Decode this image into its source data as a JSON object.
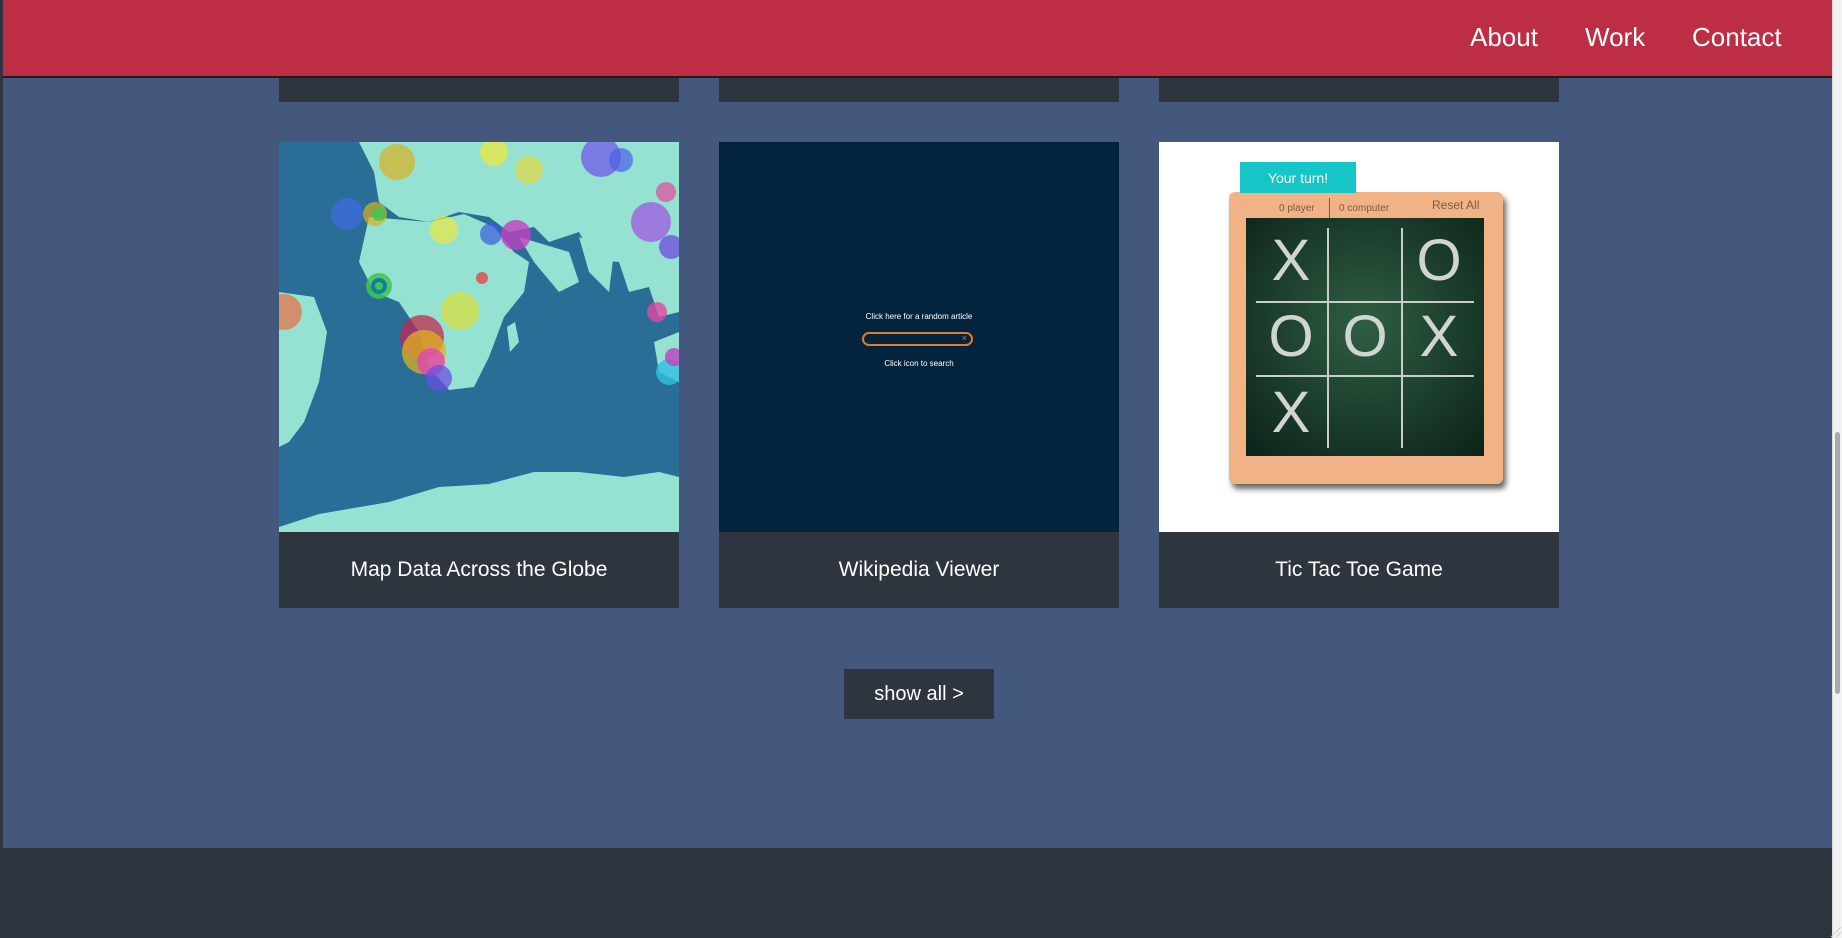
{
  "nav": {
    "links": [
      "About",
      "Work",
      "Contact"
    ]
  },
  "projects": [
    {
      "title": "Map Data Across the Globe",
      "thumbnail": "world-map-meteorite-data"
    },
    {
      "title": "Wikipedia Viewer",
      "thumbnail": "wikipedia-viewer-search",
      "random_text": "Click here for a random article",
      "clear_icon": "×",
      "hint_text": "Click icon to search"
    },
    {
      "title": "Tic Tac Toe Game",
      "thumbnail": "tic-tac-toe-chalkboard",
      "turn_text": "Your turn!",
      "player_label": "player",
      "computer_label": "computer",
      "player_score": "0",
      "computer_score": "0",
      "reset_label": "Reset All",
      "board": [
        "X",
        "",
        "O",
        "O",
        "O",
        "X",
        "X",
        "",
        ""
      ]
    }
  ],
  "show_all_label": "show all >",
  "colors": {
    "navbar": "#bd2d44",
    "page_background": "#44577d",
    "card": "#2f353e",
    "footer": "#2f353e"
  }
}
